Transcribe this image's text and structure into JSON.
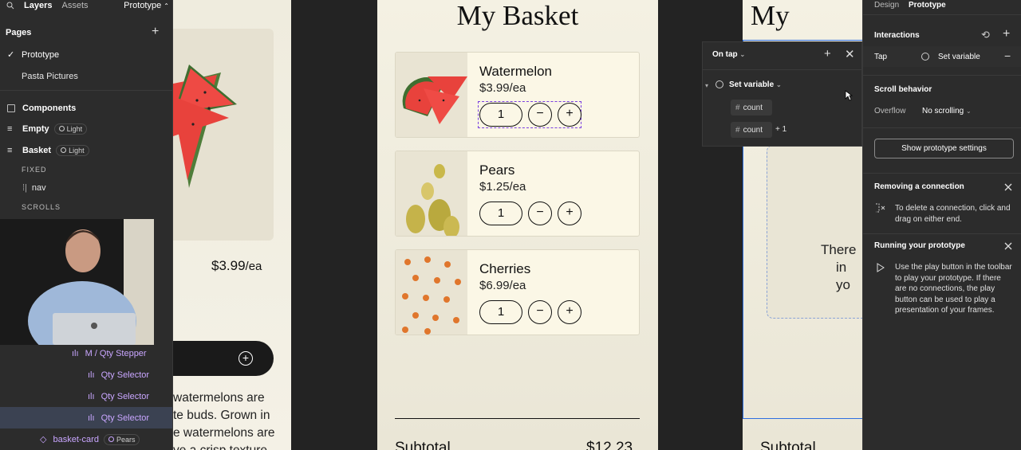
{
  "left_panel": {
    "tabs": {
      "layers": "Layers",
      "assets": "Assets",
      "prototype": "Prototype"
    },
    "pages_title": "Pages",
    "pages": [
      "Prototype",
      "Pasta Pictures"
    ],
    "layers": {
      "components": "Components",
      "empty": "Empty",
      "empty_mode": "Light",
      "basket": "Basket",
      "basket_mode": "Light",
      "fixed": "FIXED",
      "nav": "nav",
      "scrolls": "SCROLLS",
      "stepper": "M / Qty Stepper",
      "qty_selectors": [
        "Qty Selector",
        "Qty Selector",
        "Qty Selector"
      ],
      "basket_card": "basket-card",
      "basket_card_badge": "Pears"
    }
  },
  "canvas": {
    "left_frame": {
      "price": "$3.99",
      "unit": "/ea",
      "text_lines": [
        "watermelons are",
        "te buds. Grown in",
        "e watermelons are",
        "ve a crisp texture"
      ]
    },
    "basket": {
      "title": "My Basket",
      "items": [
        {
          "name": "Watermelon",
          "price": "$3.99/ea",
          "qty": "1"
        },
        {
          "name": "Pears",
          "price": "$1.25/ea",
          "qty": "1"
        },
        {
          "name": "Cherries",
          "price": "$6.99/ea",
          "qty": "1"
        }
      ],
      "minus": "−",
      "plus": "+",
      "subtotal_label": "Subtotal",
      "subtotal_value": "$12.23"
    },
    "right_frame": {
      "title": "My",
      "text_lines": [
        "There",
        "in yo"
      ],
      "subtotal_label": "Subtotal"
    }
  },
  "popover": {
    "trigger": "On tap",
    "action": "Set variable",
    "chip1": "count",
    "chip2": "count",
    "op": "+ 1"
  },
  "right_panel": {
    "tabs": {
      "design": "Design",
      "prototype": "Prototype"
    },
    "interactions": "Interactions",
    "trigger": "Tap",
    "action": "Set variable",
    "scroll_behavior": "Scroll behavior",
    "overflow_label": "Overflow",
    "overflow_value": "No scrolling",
    "show_settings": "Show prototype settings",
    "removing_title": "Removing a connection",
    "removing_text": "To delete a connection, click and drag on either end.",
    "running_title": "Running your prototype",
    "running_text": "Use the play button in the toolbar to play your prototype. If there are no connections, the play button can be used to play a presentation of your frames."
  }
}
